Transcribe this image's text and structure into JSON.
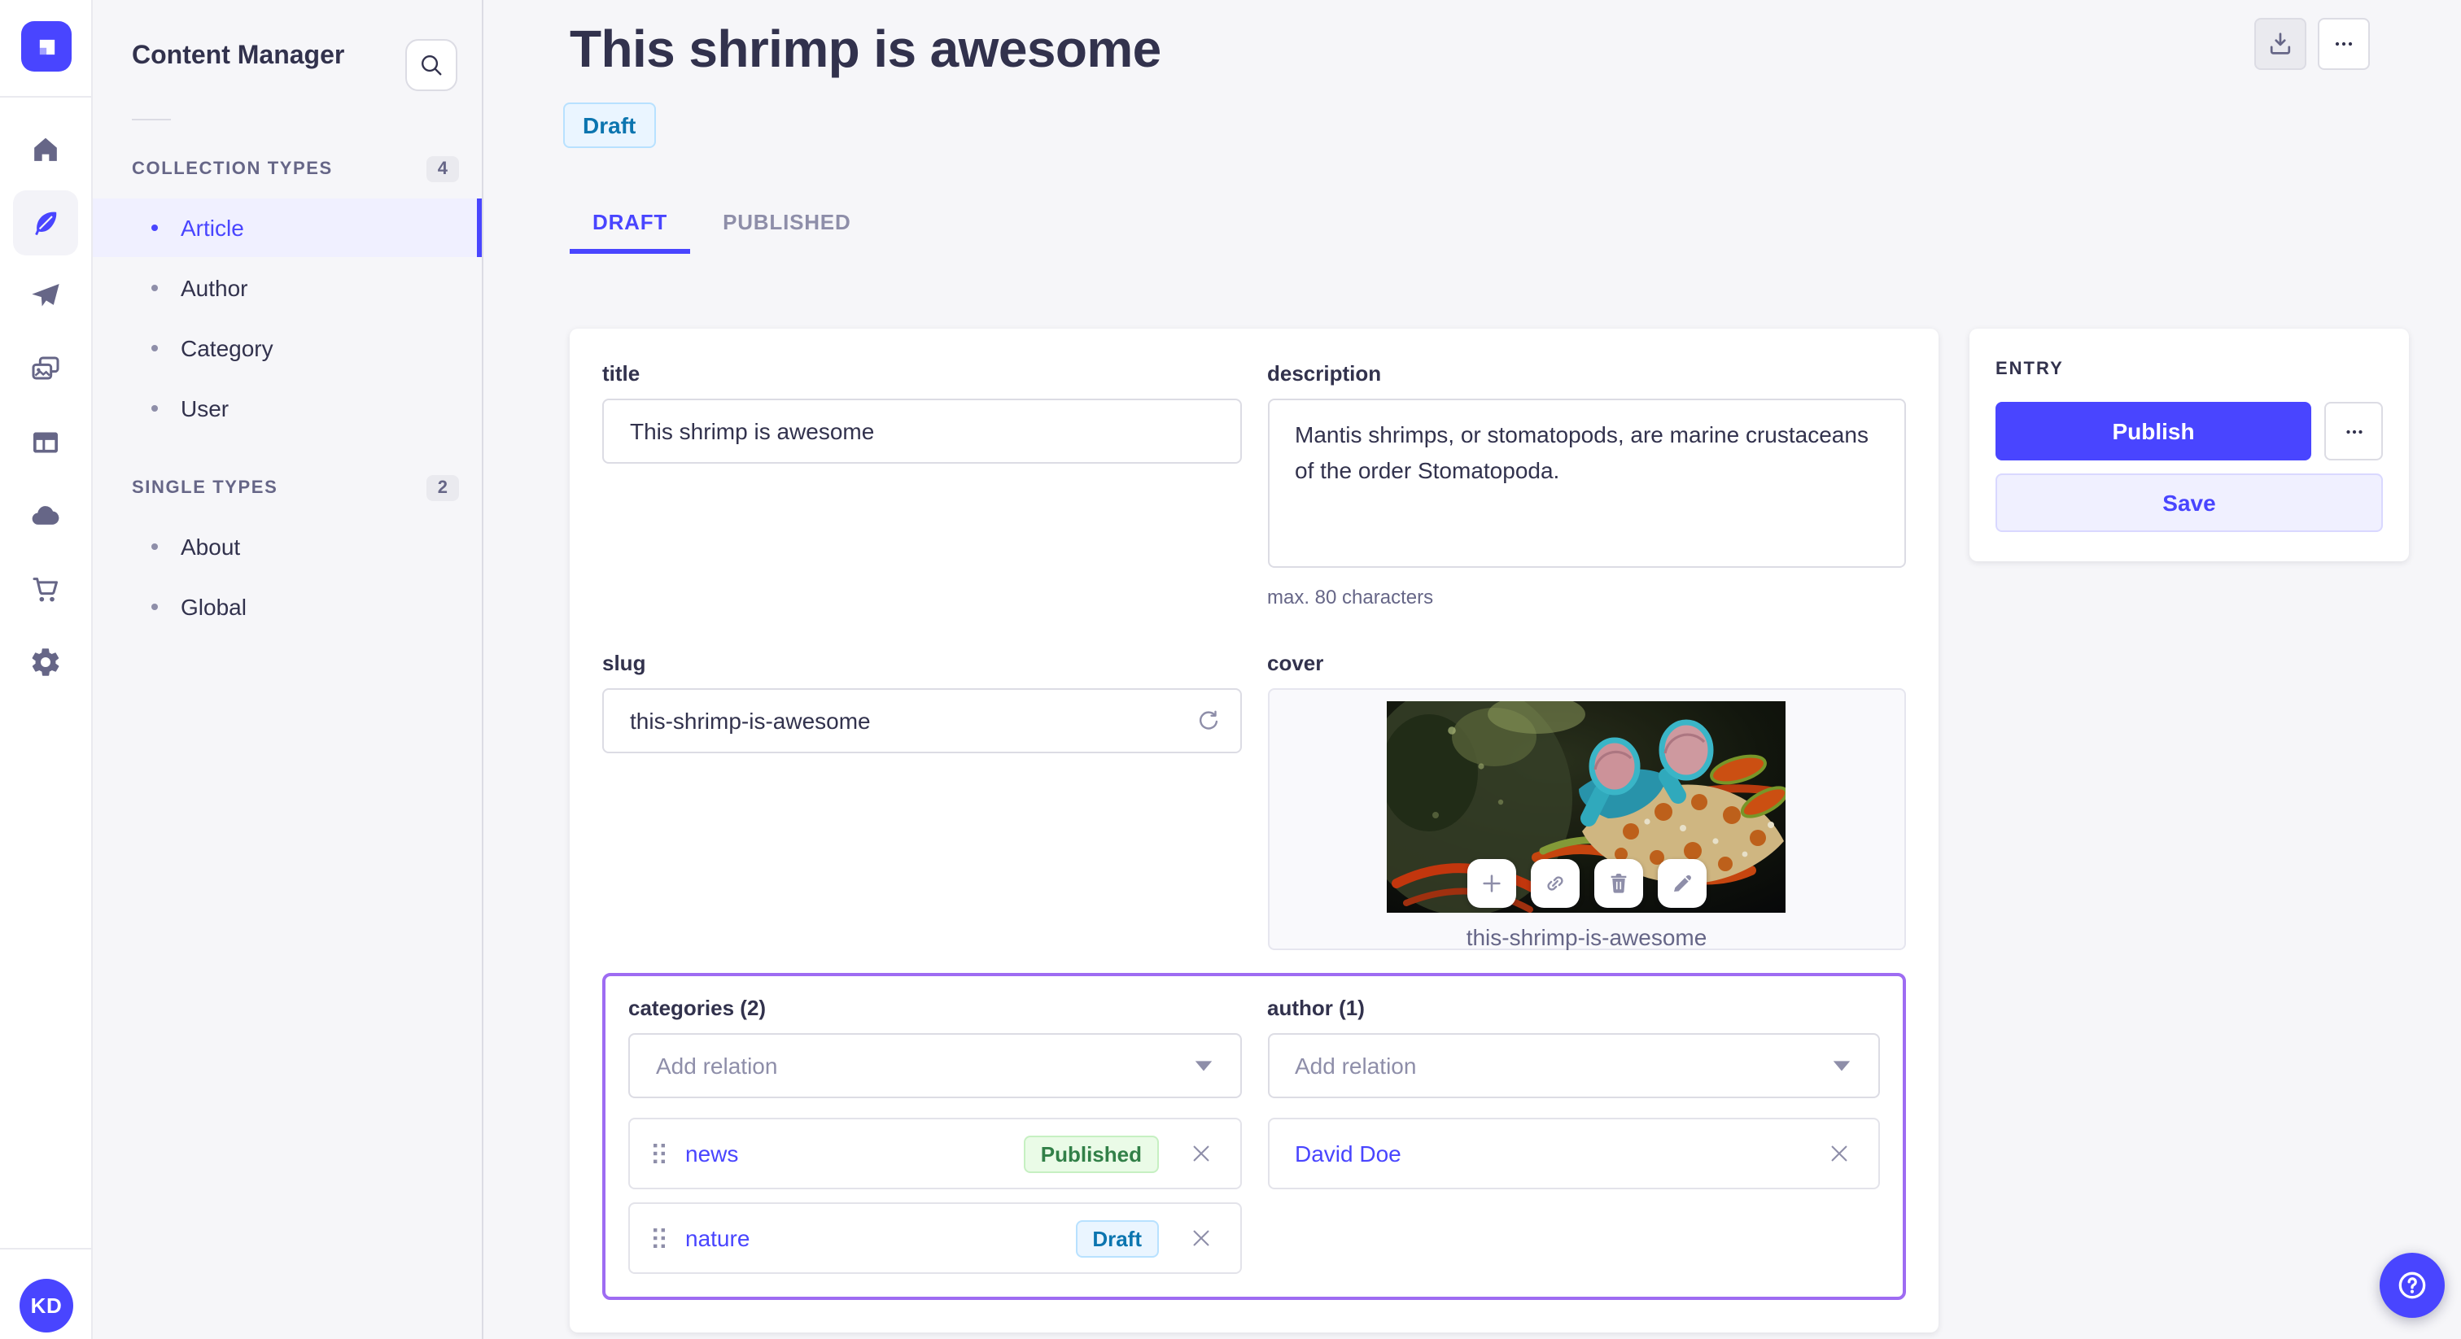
{
  "app": {
    "accent_color": "#4945ff",
    "user_initials": "KD",
    "iconbar_icons": [
      "strapi-logo",
      "home-icon",
      "feather-icon (active)",
      "paper-plane-icon",
      "media-gallery-icon",
      "layout-icon",
      "cloud-icon",
      "shopping-cart-icon",
      "settings-gear-icon"
    ]
  },
  "sidebar": {
    "title": "Content Manager",
    "search_icon": "search-icon",
    "sections": [
      {
        "label": "COLLECTION TYPES",
        "count": "4",
        "items": [
          {
            "label": "Article",
            "active": true
          },
          {
            "label": "Author"
          },
          {
            "label": "Category"
          },
          {
            "label": "User"
          }
        ]
      },
      {
        "label": "SINGLE TYPES",
        "count": "2",
        "items": [
          {
            "label": "About"
          },
          {
            "label": "Global"
          }
        ]
      }
    ]
  },
  "header": {
    "title": "This shrimp is awesome",
    "status_badge": "Draft",
    "tabs": [
      {
        "label": "DRAFT",
        "active": true
      },
      {
        "label": "PUBLISHED",
        "active": false
      }
    ],
    "toolbar_icons": [
      "download-icon",
      "more-options-icon"
    ]
  },
  "form": {
    "title": {
      "label": "title",
      "value": "This shrimp is awesome"
    },
    "description": {
      "label": "description",
      "value": "Mantis shrimps, or stomatopods, are marine crustaceans of the order Stomatopoda.",
      "helper": "max. 80 characters"
    },
    "slug": {
      "label": "slug",
      "value": "this-shrimp-is-awesome",
      "action_icon": "regenerate-icon"
    },
    "cover": {
      "label": "cover",
      "caption": "this-shrimp-is-awesome",
      "action_icons": [
        "plus-icon",
        "link-icon",
        "trash-icon",
        "pencil-icon"
      ]
    },
    "categories": {
      "label": "categories (2)",
      "placeholder": "Add relation",
      "items": [
        {
          "name": "news",
          "status": "Published"
        },
        {
          "name": "nature",
          "status": "Draft"
        }
      ]
    },
    "author": {
      "label": "author (1)",
      "placeholder": "Add relation",
      "items": [
        {
          "name": "David Doe"
        }
      ]
    },
    "highlight_outline_color": "#9e6cf2"
  },
  "entry_panel": {
    "label": "ENTRY",
    "publish_label": "Publish",
    "save_label": "Save",
    "more_icon": "more-options-icon"
  },
  "status_colors": {
    "draft": {
      "bg": "#eaf5ff",
      "border": "#b8e1ff",
      "text": "#0c75af"
    },
    "published": {
      "bg": "#eafbe7",
      "border": "#c6f0c2",
      "text": "#328048"
    }
  },
  "fab": {
    "icon": "help-question-icon"
  }
}
